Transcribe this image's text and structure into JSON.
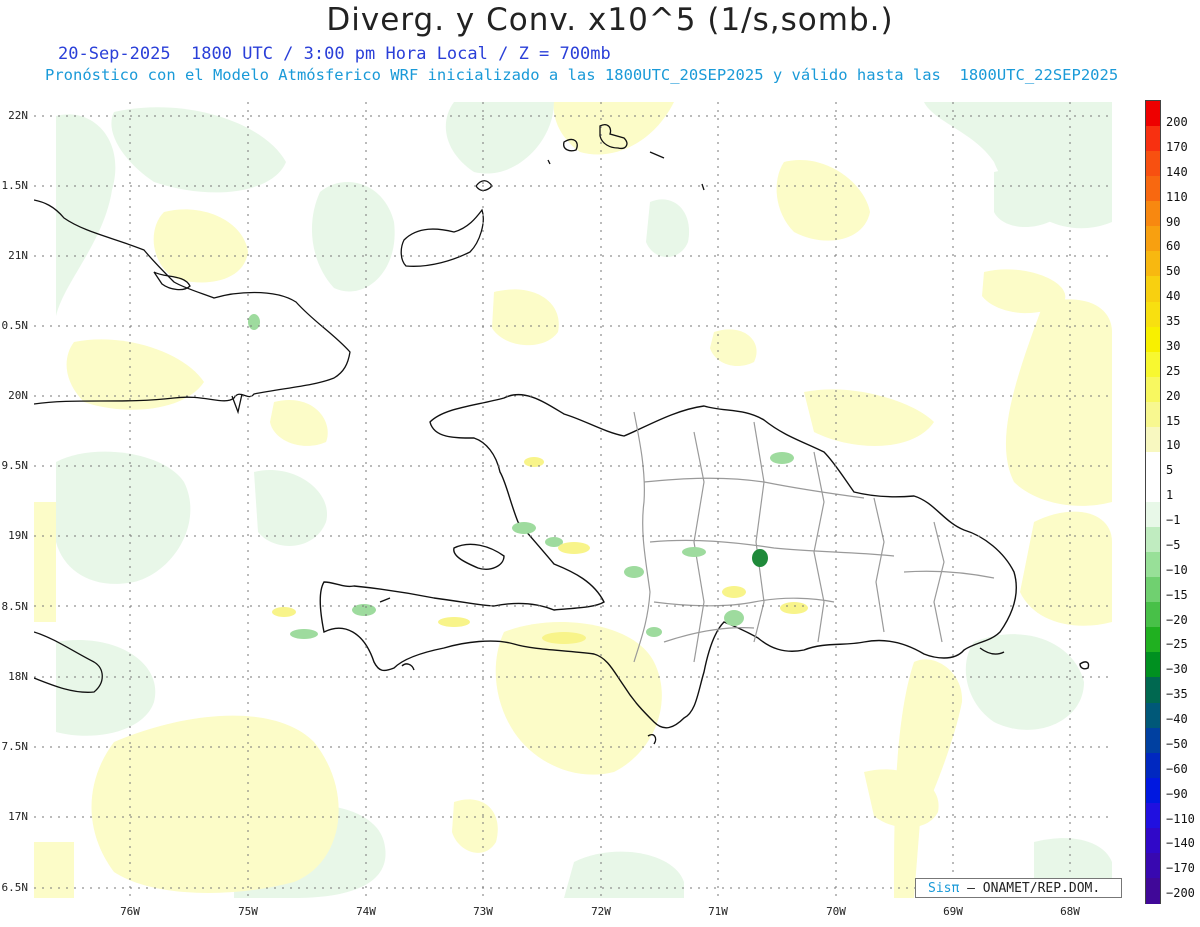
{
  "title": "Diverg. y Conv. x10^5 (1/s,somb.)",
  "subtitle_line1": "20-Sep-2025  1800 UTC / 3:00 pm Hora Local / Z = 700mb",
  "subtitle_line2": "Pronóstico con el Modelo Atmósferico WRF inicializado a las 1800UTC_20SEP2025 y válido hasta las  1800UTC_22SEP2025",
  "latitude_labels": [
    "22N",
    "1.5N",
    "21N",
    "0.5N",
    "20N",
    "9.5N",
    "19N",
    "8.5N",
    "18N",
    "7.5N",
    "17N",
    "6.5N"
  ],
  "longitude_labels": [
    "76W",
    "75W",
    "74W",
    "73W",
    "72W",
    "71W",
    "70W",
    "69W",
    "68W"
  ],
  "colorbar": {
    "levels": [
      "200",
      "170",
      "140",
      "110",
      "90",
      "60",
      "50",
      "40",
      "35",
      "30",
      "25",
      "20",
      "15",
      "10",
      "5",
      "1",
      "−1",
      "−5",
      "−10",
      "−15",
      "−20",
      "−25",
      "−30",
      "−35",
      "−40",
      "−50",
      "−60",
      "−90",
      "−110",
      "−140",
      "−170",
      "−200"
    ],
    "colors": [
      "#ee0000",
      "#f83010",
      "#f85010",
      "#f86810",
      "#f88810",
      "#f8a010",
      "#f8b810",
      "#f8d010",
      "#f8e010",
      "#f8f000",
      "#f8f830",
      "#f8f860",
      "#f8f890",
      "#f8f8c0",
      "#ffffff",
      "#ffffff",
      "#e8f8e8",
      "#c0ecc0",
      "#98e098",
      "#70d070",
      "#48c048",
      "#20b020",
      "#009020",
      "#006850",
      "#005878",
      "#0040a0",
      "#0028c0",
      "#0018e0",
      "#2010e0",
      "#3008c8",
      "#3808b0",
      "#400898"
    ]
  },
  "credit": {
    "brand": "Sisπ",
    "text": " – ONAMET/REP.DOM."
  },
  "colors": {
    "divergence_light": "#fcfcc4",
    "convergence_light": "#e6f6e6",
    "convergence_mid": "#8fd68f",
    "convergence_strong": "#1f8a3a",
    "coast": "#111111",
    "provinces": "#9a9a9a"
  }
}
